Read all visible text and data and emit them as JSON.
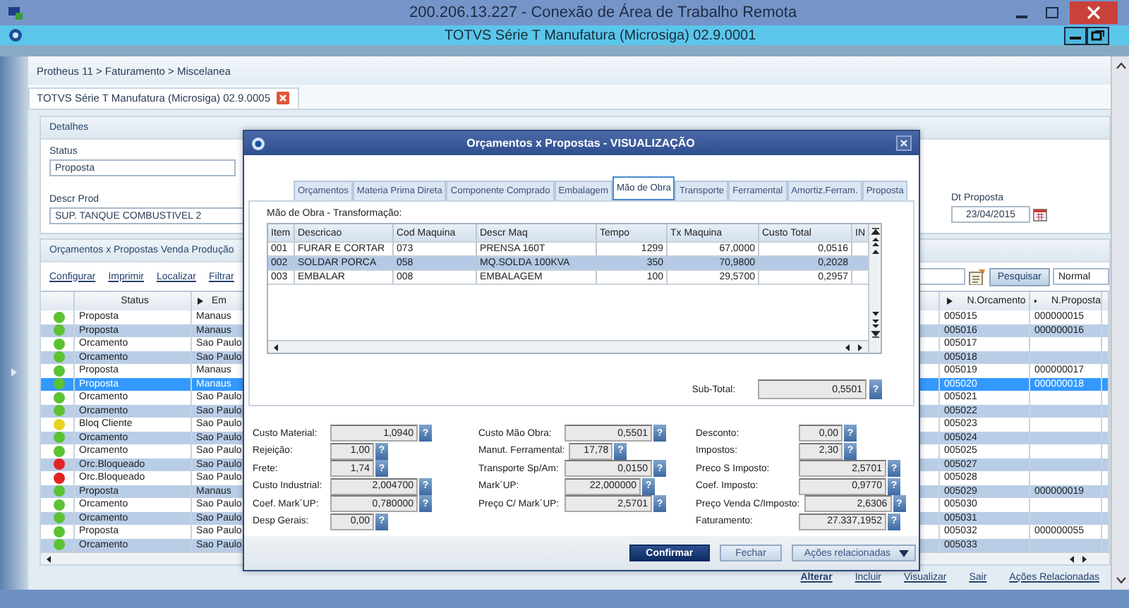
{
  "rdp_window": {
    "title": "200.206.13.227 - Conexão de Área de Trabalho Remota"
  },
  "app_window": {
    "title": "TOTVS Série T Manufatura (Microsiga) 02.9.0001"
  },
  "breadcrumb": "Protheus 11 > Faturamento > Miscelanea",
  "document_tab": {
    "label": "TOTVS Série T Manufatura (Microsiga) 02.9.0005"
  },
  "details": {
    "title": "Detalhes",
    "status": {
      "label": "Status",
      "value": "Proposta"
    },
    "descr_prod": {
      "label": "Descr Prod",
      "value": "SUP. TANQUE COMBUSTIVEL 2"
    },
    "dt_proposta": {
      "label": "Dt Proposta",
      "value": "23/04/2015"
    }
  },
  "grid_panel": {
    "title": "Orçamentos x Propostas Venda Produção",
    "links": [
      "Configurar",
      "Imprimir",
      "Localizar",
      "Filtrar"
    ],
    "search_button": "Pesquisar",
    "view_select": "Normal",
    "columns": [
      "Status",
      "Em",
      "N.Orcamento",
      "N.Proposta"
    ],
    "rows": [
      {
        "status": "Proposta",
        "city": "Manaus",
        "n_orcamento": "005015",
        "n_proposta": "000000015",
        "color": "#5cc232",
        "selected": false
      },
      {
        "status": "Proposta",
        "city": "Manaus",
        "n_orcamento": "005016",
        "n_proposta": "000000016",
        "color": "#5cc232",
        "selected": false
      },
      {
        "status": "Orcamento",
        "city": "Sao Paulo",
        "n_orcamento": "005017",
        "n_proposta": "",
        "color": "#5cc232",
        "selected": false
      },
      {
        "status": "Orcamento",
        "city": "Sao Paulo",
        "n_orcamento": "005018",
        "n_proposta": "",
        "color": "#5cc232",
        "selected": false
      },
      {
        "status": "Proposta",
        "city": "Manaus",
        "n_orcamento": "005019",
        "n_proposta": "000000017",
        "color": "#5cc232",
        "selected": false
      },
      {
        "status": "Proposta",
        "city": "Manaus",
        "n_orcamento": "005020",
        "n_proposta": "000000018",
        "color": "#5cc232",
        "selected": true
      },
      {
        "status": "Orcamento",
        "city": "Sao Paulo",
        "n_orcamento": "005021",
        "n_proposta": "",
        "color": "#5cc232",
        "selected": false
      },
      {
        "status": "Orcamento",
        "city": "Sao Paulo",
        "n_orcamento": "005022",
        "n_proposta": "",
        "color": "#5cc232",
        "selected": false
      },
      {
        "status": "Bloq Cliente",
        "city": "Sao Paulo",
        "n_orcamento": "005023",
        "n_proposta": "",
        "color": "#e8d420",
        "selected": false
      },
      {
        "status": "Orcamento",
        "city": "Sao Paulo",
        "n_orcamento": "005024",
        "n_proposta": "",
        "color": "#5cc232",
        "selected": false
      },
      {
        "status": "Orcamento",
        "city": "Sao Paulo",
        "n_orcamento": "005025",
        "n_proposta": "",
        "color": "#5cc232",
        "selected": false
      },
      {
        "status": "Orc.Bloqueado",
        "city": "Sao Paulo",
        "n_orcamento": "005027",
        "n_proposta": "",
        "color": "#e02424",
        "selected": false
      },
      {
        "status": "Orc.Bloqueado",
        "city": "Sao Paulo",
        "n_orcamento": "005028",
        "n_proposta": "",
        "color": "#e02424",
        "selected": false
      },
      {
        "status": "Proposta",
        "city": "Manaus",
        "n_orcamento": "005029",
        "n_proposta": "000000019",
        "color": "#5cc232",
        "selected": false
      },
      {
        "status": "Orcamento",
        "city": "Sao Paulo",
        "n_orcamento": "005030",
        "n_proposta": "",
        "color": "#5cc232",
        "selected": false
      },
      {
        "status": "Orcamento",
        "city": "Sao Paulo",
        "n_orcamento": "005031",
        "n_proposta": "",
        "color": "#5cc232",
        "selected": false
      },
      {
        "status": "Proposta",
        "city": "Sao Paulo",
        "n_orcamento": "005032",
        "n_proposta": "000000055",
        "color": "#5cc232",
        "selected": false
      },
      {
        "status": "Orcamento",
        "city": "Sao Paulo",
        "n_orcamento": "005033",
        "n_proposta": "",
        "color": "#5cc232",
        "selected": false
      }
    ]
  },
  "bottom_actions": [
    {
      "label": "Alterar",
      "default": true
    },
    {
      "label": "Incluir",
      "default": false
    },
    {
      "label": "Visualizar",
      "default": false
    },
    {
      "label": "Sair",
      "default": false
    },
    {
      "label": "Ações Relacionadas",
      "default": false
    }
  ],
  "dialog": {
    "title": "Orçamentos x Propostas - VISUALIZAÇÃO",
    "tabs": [
      {
        "label": "Orçamentos",
        "selected": false
      },
      {
        "label": "Materia Prima Direta",
        "selected": false
      },
      {
        "label": "Componente Comprado",
        "selected": false
      },
      {
        "label": "Embalagem",
        "selected": false
      },
      {
        "label": "Mão de Obra",
        "selected": true
      },
      {
        "label": "Transporte",
        "selected": false
      },
      {
        "label": "Ferramental",
        "selected": false
      },
      {
        "label": "Amortiz.Ferram.",
        "selected": false
      },
      {
        "label": "Proposta",
        "selected": false
      }
    ],
    "section_label": "Mão de Obra - Transformação:",
    "columns": [
      "Item",
      "Descricao",
      "Cod Maquina",
      "Descr Maq",
      "Tempo",
      "Tx Maquina",
      "Custo Total",
      "IN"
    ],
    "rows": [
      {
        "cells": [
          "001",
          "FURAR E CORTAR",
          "073",
          "PRENSA 160T",
          "1299",
          "67,0000",
          "0,0516"
        ],
        "selected": false
      },
      {
        "cells": [
          "002",
          "SOLDAR PORCA",
          "058",
          "MQ.SOLDA 100KVA",
          "350",
          "70,9800",
          "0,2028"
        ],
        "selected": true
      },
      {
        "cells": [
          "003",
          "EMBALAR",
          "008",
          "EMBALAGEM",
          "100",
          "29,5700",
          "0,2957"
        ],
        "selected": false
      }
    ],
    "help_label": "?",
    "subtotal": {
      "label": "Sub-Total:",
      "value": "0,5501"
    },
    "totals": [
      [
        {
          "label": "Custo Material:",
          "value": "1,0940",
          "kind": "long"
        },
        {
          "label": "Rejeição:",
          "value": "1,00",
          "kind": "short"
        },
        {
          "label": "Frete:",
          "value": "1,74",
          "kind": "short"
        },
        {
          "label": "Custo Industrial:",
          "value": "2,004700",
          "kind": "long"
        },
        {
          "label": "Coef. Mark´UP:",
          "value": "0,780000",
          "kind": "long"
        },
        {
          "label": "Desp Gerais:",
          "value": "0,00",
          "kind": "short"
        }
      ],
      [
        {
          "label": "Custo Mão Obra:",
          "value": "0,5501",
          "kind": "long"
        },
        {
          "label": "Manut. Ferramental:",
          "value": "17,78",
          "kind": "short"
        },
        {
          "label": "Transporte Sp/Am:",
          "value": "0,0150",
          "kind": "long"
        },
        {
          "label": "Mark´UP:",
          "value": "22,000000",
          "kind": "medium"
        },
        {
          "label": "Preço C/ Mark´UP:",
          "value": "2,5701",
          "kind": "long"
        }
      ],
      [
        {
          "label": "Desconto:",
          "value": "0,00",
          "kind": "short"
        },
        {
          "label": "Impostos:",
          "value": "2,30",
          "kind": "short"
        },
        {
          "label": "Preco S Imposto:",
          "value": "2,5701",
          "kind": "long"
        },
        {
          "label": "Coef. Imposto:",
          "value": "0,9770",
          "kind": "long"
        },
        {
          "label": "Preço Venda C/Imposto:",
          "value": "2,6306",
          "kind": "long"
        },
        {
          "label": "Faturamento:",
          "value": "27.337,1952",
          "kind": "long"
        }
      ]
    ],
    "buttons": [
      {
        "label": "Confirmar",
        "kind": "primary"
      },
      {
        "label": "Fechar",
        "kind": "secondary"
      },
      {
        "label": "Ações relacionadas",
        "kind": "menu"
      }
    ]
  }
}
